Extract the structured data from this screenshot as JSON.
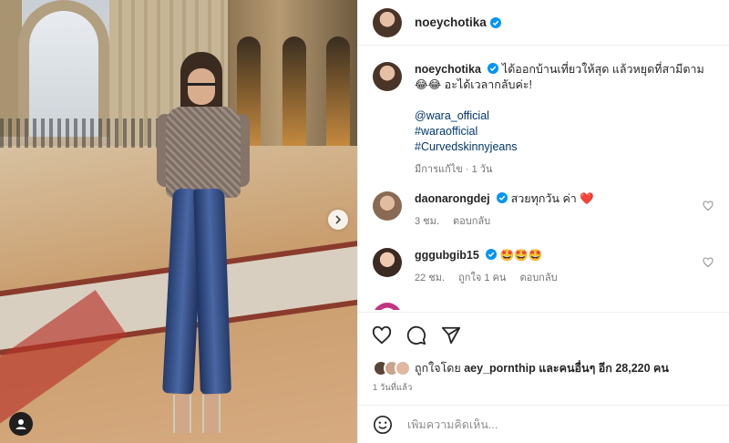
{
  "colors": {
    "verified": "#0095f6",
    "heart": "#ed4956",
    "link": "#00376b",
    "muted": "#737373"
  },
  "post": {
    "author": "noeychotika",
    "caption_line1": "ได้ออกบ้านเที่ยวให้สุด แล้วหยุดที่สามีตาม",
    "caption_line2": "😂😂 อะได้เวลากลับค่ะ!",
    "tags": [
      "@wara_official",
      "#waraofficial",
      "#Curvedskinnyjeans"
    ],
    "edited": "มีการแก้ไข · 1 วัน"
  },
  "comments": [
    {
      "user": "daonarongdej",
      "text": "สวยทุกวัน ค่า",
      "emoji": "❤️",
      "time": "3 ชม.",
      "reply": "ตอบกลับ",
      "likes": ""
    },
    {
      "user": "gggubgib15",
      "text": "🤩🤩🤩",
      "emoji": "",
      "time": "22 ชม.",
      "reply": "ตอบกลับ",
      "likes": "ถูกใจ 1 คน"
    }
  ],
  "likes": {
    "prefix": "ถูกใจโดย",
    "user": "aey_pornthip",
    "suffix": "และคนอื่นๆ อีก 28,220 คน"
  },
  "posted_time": "1 วันที่แล้ว",
  "comment_placeholder": "เพิ่มความคิดเห็น...",
  "icons": [
    "heart-icon",
    "comment-icon",
    "share-icon",
    "next-icon",
    "tag-user-icon",
    "emoji-icon",
    "verified-icon"
  ]
}
